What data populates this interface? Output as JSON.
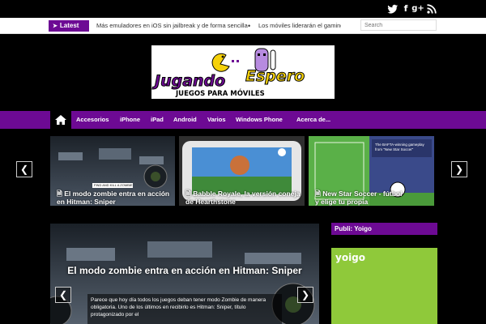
{
  "social": {
    "twitter": "t",
    "facebook": "f",
    "googleplus": "g+",
    "rss": "rss"
  },
  "ticker": {
    "badge": "Latest",
    "items": [
      "Más emuladores en iOS sin jailbreak y de forma sencilla",
      "Los móviles liderarán el gaming de"
    ],
    "separator": "•"
  },
  "search": {
    "placeholder": "Search"
  },
  "logo": {
    "line1_left": "Jugando",
    "line1_right": "Espero",
    "tagline": "JUEGOS PARA MÓVILES"
  },
  "nav": {
    "items": [
      "Accesorios",
      "iPhone",
      "iPad",
      "Android",
      "Varios",
      "Windows Phone",
      "Acerca de..."
    ]
  },
  "slider": {
    "slides": [
      {
        "caption": "El modo zombie entra en acción en Hitman: Sniper",
        "overlay": "FIND AND KILL A ZOMBIE"
      },
      {
        "caption": "Babble Royale, la versión coneja de Hearthstone"
      },
      {
        "caption": "New Star Soccer - fútbol y elige tu propia",
        "banner1": "The BAFTA-winning gameplay",
        "banner2": "from \"New Star Soccer\""
      }
    ]
  },
  "feature": {
    "title": "El modo zombie entra en acción en Hitman: Sniper",
    "excerpt": "Parece que hoy día todos los juegos deban tener modo Zombie de manera obligatoria. Uno de los últimos en recibirlo es Hitman: Sniper, título protagonizado por el"
  },
  "sidebar": {
    "widget_title": "Publi: Yoigo",
    "ad_logo": "yoigo"
  },
  "colors": {
    "brand": "#6d0a94",
    "ad_green": "#8fc93a"
  }
}
